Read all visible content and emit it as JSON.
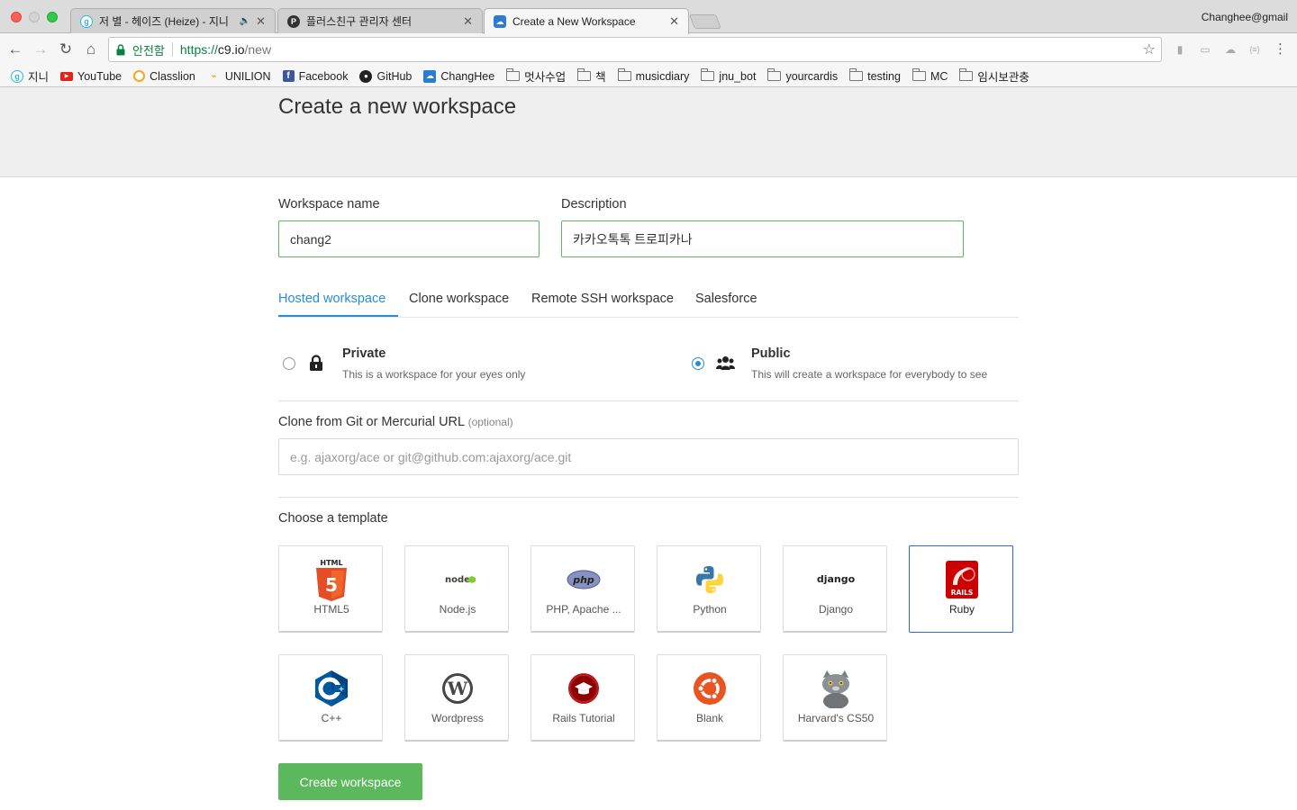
{
  "browser": {
    "tabs": [
      {
        "title": "저 별 - 헤이즈 (Heize) - 지니",
        "favicon": "genie-icon",
        "audio": "🔈"
      },
      {
        "title": "플러스친구 관리자 센터",
        "favicon": "plusfriend-icon"
      },
      {
        "title": "Create a New Workspace",
        "favicon": "c9-cloud-icon",
        "active": true
      }
    ],
    "profile": "Changhee@gmail",
    "address": {
      "secure_label": "안전함",
      "scheme": "https://",
      "host": "c9.io",
      "path": "/new"
    },
    "bookmarks": [
      {
        "label": "지니",
        "icon": "genie-icon",
        "color": "#2fb5e6"
      },
      {
        "label": "YouTube",
        "icon": "youtube-icon",
        "color": "#e62117"
      },
      {
        "label": "Classlion",
        "icon": "classlion-icon",
        "color": "#f5a623"
      },
      {
        "label": "UNILION",
        "icon": "unilion-icon",
        "color": "#333333"
      },
      {
        "label": "Facebook",
        "icon": "facebook-icon",
        "color": "#3b5998"
      },
      {
        "label": "GitHub",
        "icon": "github-icon",
        "color": "#222222"
      },
      {
        "label": "ChangHee",
        "icon": "c9-cloud-icon",
        "color": "#2a7bd6"
      },
      {
        "label": "멋사수업",
        "icon": "folder-icon"
      },
      {
        "label": "책",
        "icon": "folder-icon"
      },
      {
        "label": "musicdiary",
        "icon": "folder-icon"
      },
      {
        "label": "jnu_bot",
        "icon": "folder-icon"
      },
      {
        "label": "yourcardis",
        "icon": "folder-icon"
      },
      {
        "label": "testing",
        "icon": "folder-icon"
      },
      {
        "label": "MC",
        "icon": "folder-icon"
      },
      {
        "label": "임시보관충",
        "icon": "folder-icon"
      }
    ]
  },
  "page": {
    "title": "Create a new workspace",
    "workspace_name": {
      "label": "Workspace name",
      "value": "chang2"
    },
    "description": {
      "label": "Description",
      "value": "카카오톡톡 트로피카나"
    },
    "tabs": [
      "Hosted workspace",
      "Clone workspace",
      "Remote SSH workspace",
      "Salesforce"
    ],
    "visibility": {
      "private": {
        "title": "Private",
        "desc": "This is a workspace for your eyes only",
        "checked": false
      },
      "public": {
        "title": "Public",
        "desc": "This will create a workspace for everybody to see",
        "checked": true
      }
    },
    "clone": {
      "label": "Clone from Git or Mercurial URL",
      "optional": "(optional)",
      "placeholder": "e.g. ajaxorg/ace or git@github.com:ajaxorg/ace.git"
    },
    "template_heading": "Choose a template",
    "templates": [
      {
        "label": "HTML5",
        "icon": "html5-icon"
      },
      {
        "label": "Node.js",
        "icon": "nodejs-icon"
      },
      {
        "label": "PHP, Apache ...",
        "icon": "php-icon"
      },
      {
        "label": "Python",
        "icon": "python-icon"
      },
      {
        "label": "Django",
        "icon": "django-icon"
      },
      {
        "label": "Ruby",
        "icon": "rails-icon",
        "selected": true
      },
      {
        "label": "C++",
        "icon": "cpp-icon"
      },
      {
        "label": "Wordpress",
        "icon": "wordpress-icon"
      },
      {
        "label": "Rails Tutorial",
        "icon": "rails-tutorial-icon"
      },
      {
        "label": "Blank",
        "icon": "ubuntu-icon"
      },
      {
        "label": "Harvard's CS50",
        "icon": "cs50-cat-icon"
      }
    ],
    "create_button": "Create workspace"
  },
  "colors": {
    "accent": "#2a8bd6",
    "success": "#5cb85c",
    "header_bg": "#efefef"
  }
}
